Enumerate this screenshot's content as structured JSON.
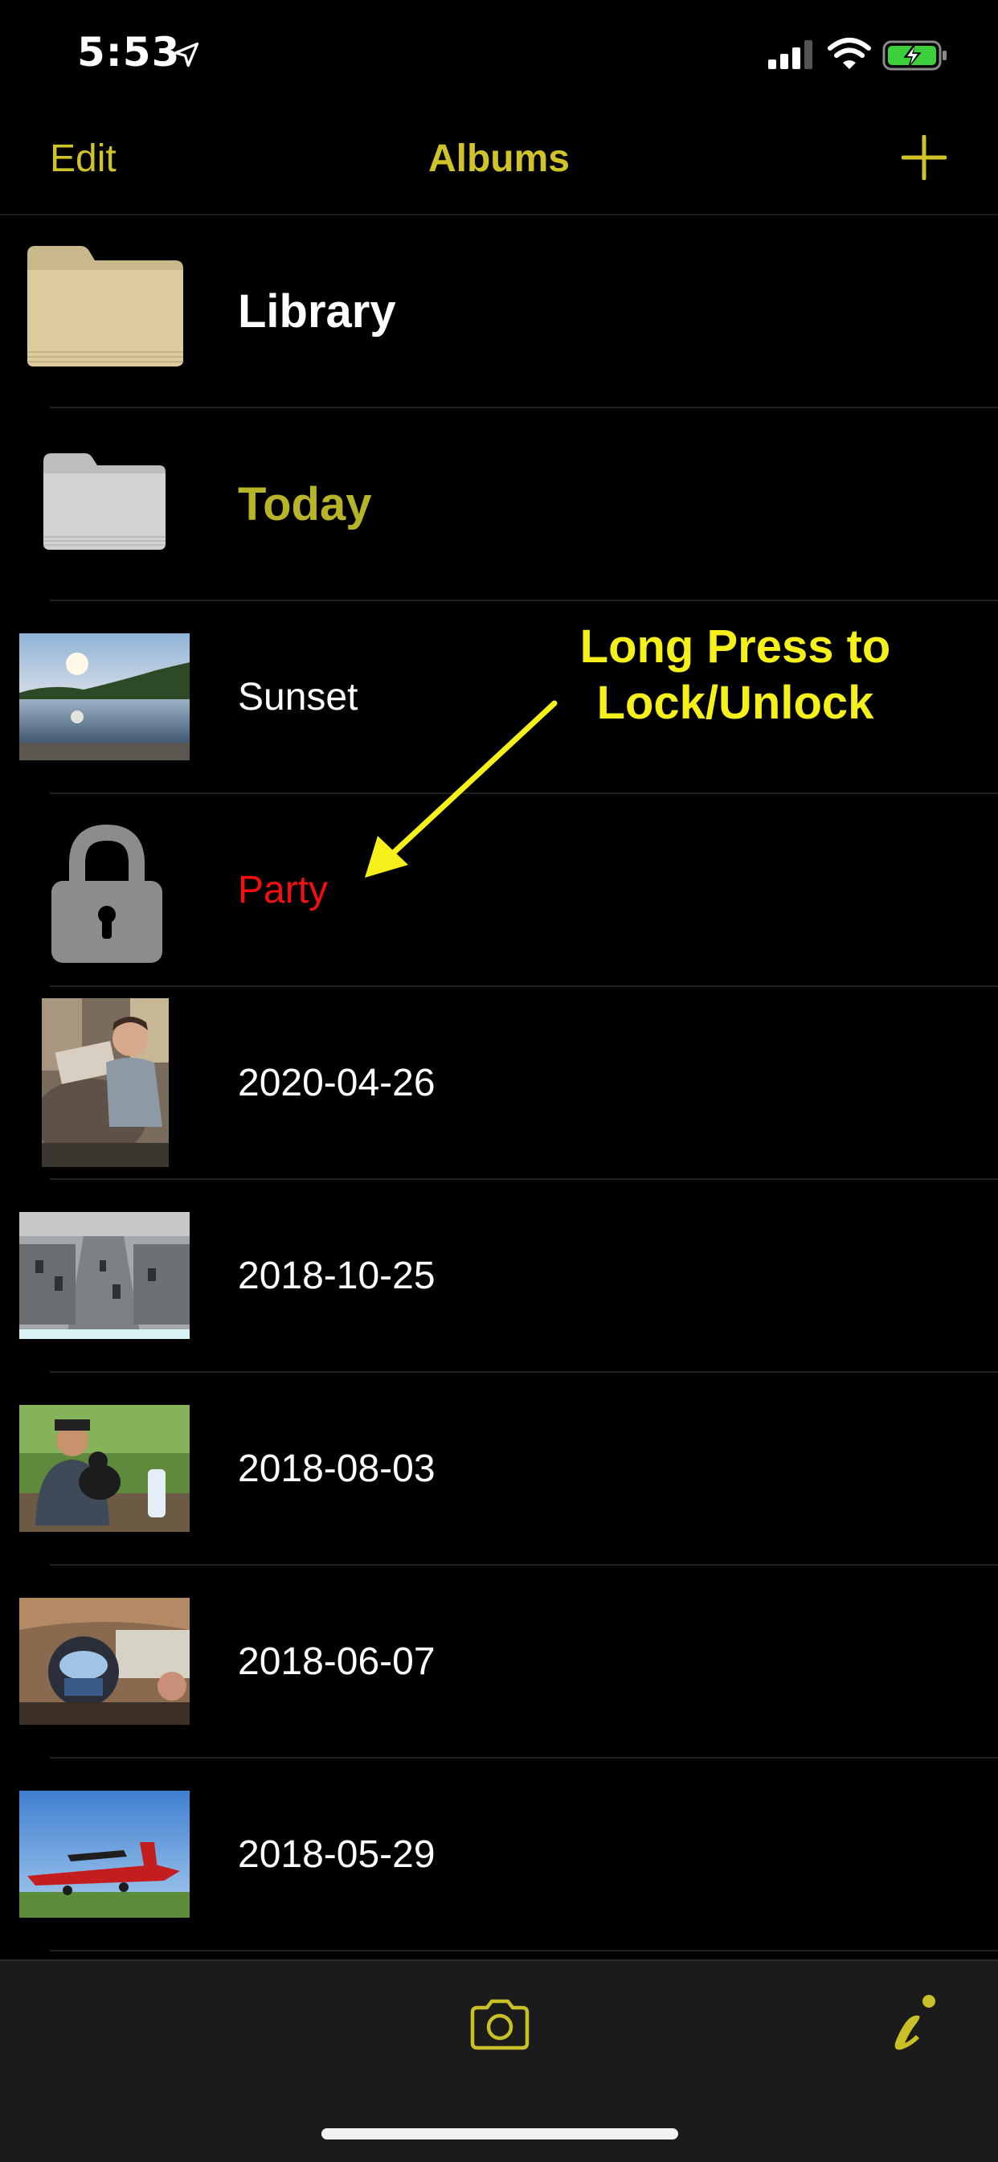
{
  "status_bar": {
    "time": "5:53",
    "icons": [
      "location-arrow-icon",
      "cellular-signal-icon",
      "wifi-icon",
      "battery-charging-icon"
    ]
  },
  "nav": {
    "edit_label": "Edit",
    "title": "Albums",
    "add_icon": "plus-icon"
  },
  "albums": [
    {
      "label": "Library",
      "icon": "folder-icon"
    },
    {
      "label": "Today",
      "icon": "folder-icon"
    },
    {
      "label": "Sunset",
      "icon": "photo-thumbnail"
    },
    {
      "label": "Party",
      "icon": "lock-icon",
      "locked": true
    },
    {
      "label": "2020-04-26",
      "icon": "photo-thumbnail"
    },
    {
      "label": "2018-10-25",
      "icon": "photo-thumbnail"
    },
    {
      "label": "2018-08-03",
      "icon": "photo-thumbnail"
    },
    {
      "label": "2018-06-07",
      "icon": "photo-thumbnail"
    },
    {
      "label": "2018-05-29",
      "icon": "photo-thumbnail"
    }
  ],
  "annotation": {
    "line1": "Long Press to",
    "line2": "Lock/Unlock"
  },
  "toolbar": {
    "icons": [
      "camera-icon",
      "info-icon"
    ]
  },
  "colors": {
    "accent": "#cfc328",
    "today": "#b8b42a",
    "locked": "#f01010",
    "annotation": "#f5ef1a",
    "background": "#000000",
    "toolbar": "#1b1b1b"
  }
}
